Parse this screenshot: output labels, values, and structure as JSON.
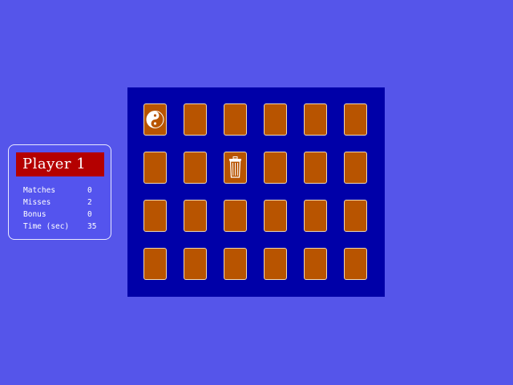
{
  "player": {
    "title": "Player 1",
    "stats": [
      {
        "label": "Matches",
        "value": "0"
      },
      {
        "label": "Misses",
        "value": "2"
      },
      {
        "label": "Bonus",
        "value": "0"
      },
      {
        "label": "Time (sec)",
        "value": "35"
      }
    ]
  },
  "board": {
    "rows": 4,
    "columns": 6,
    "cards": [
      {
        "state": "face-up",
        "symbol": "yin-yang-icon"
      },
      {
        "state": "face-down"
      },
      {
        "state": "face-down"
      },
      {
        "state": "face-down"
      },
      {
        "state": "face-down"
      },
      {
        "state": "face-down"
      },
      {
        "state": "face-down"
      },
      {
        "state": "face-down"
      },
      {
        "state": "face-up",
        "symbol": "trash-can-icon"
      },
      {
        "state": "face-down"
      },
      {
        "state": "face-down"
      },
      {
        "state": "face-down"
      },
      {
        "state": "face-down"
      },
      {
        "state": "face-down"
      },
      {
        "state": "face-down"
      },
      {
        "state": "face-down"
      },
      {
        "state": "face-down"
      },
      {
        "state": "face-down"
      },
      {
        "state": "face-down"
      },
      {
        "state": "face-down"
      },
      {
        "state": "face-down"
      },
      {
        "state": "face-down"
      },
      {
        "state": "face-down"
      },
      {
        "state": "face-down"
      }
    ]
  },
  "colors": {
    "desktop": "#5a5af0",
    "board": "#0000a8",
    "card_back": "#b85400",
    "card_border": "#f0d8b0",
    "player_banner": "#b40000"
  }
}
